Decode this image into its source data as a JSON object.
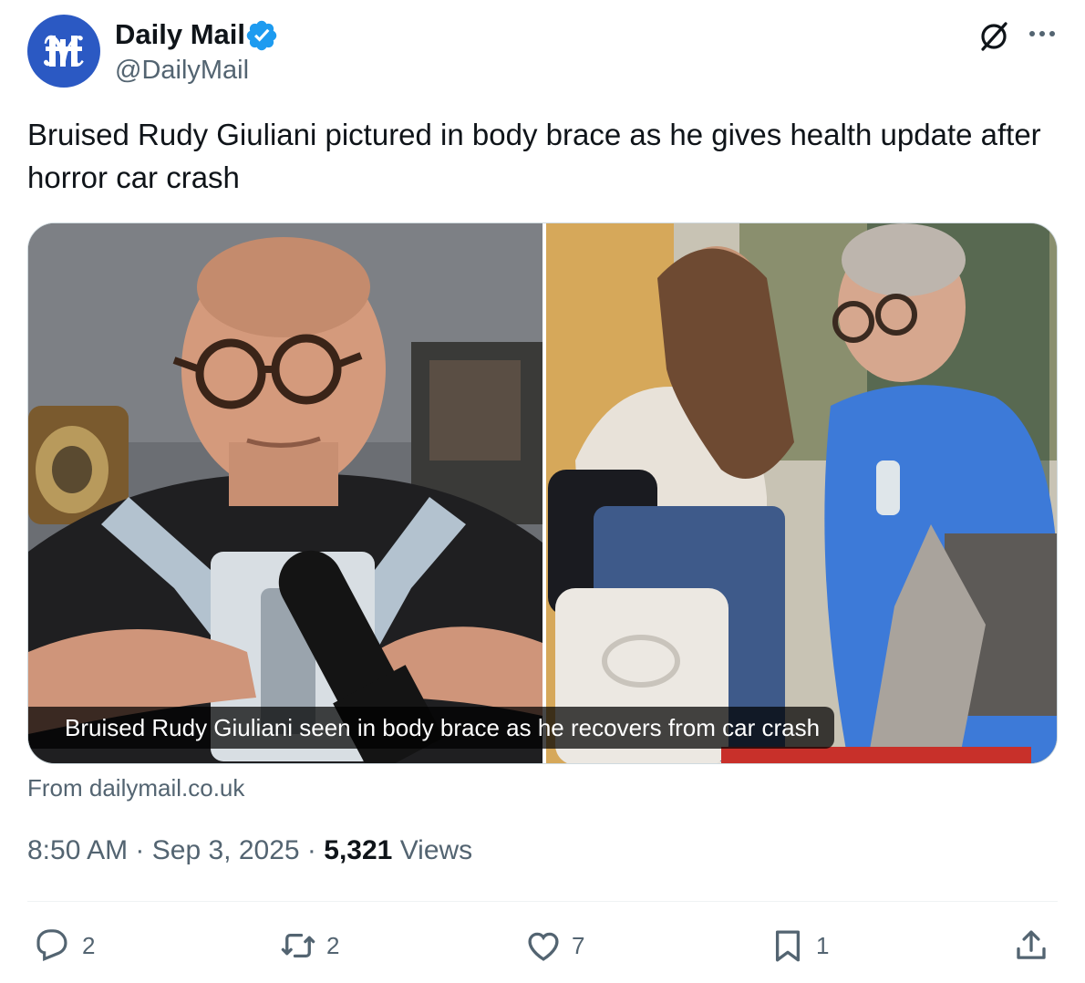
{
  "author": {
    "display_name": "Daily Mail",
    "handle": "@DailyMail",
    "verified": true,
    "avatar_icon": "daily-mail-logo",
    "avatar_color": "#2b59c3"
  },
  "tweet": {
    "text": "Bruised Rudy Giuliani pictured in body brace as he gives health update after horror car crash"
  },
  "media": {
    "caption": "Bruised Rudy Giuliani seen in body brace as he recovers from car crash",
    "source": "From dailymail.co.uk"
  },
  "meta": {
    "time": "8:50 AM",
    "separator": "·",
    "date": "Sep 3, 2025",
    "views_count": "5,321",
    "views_label": "Views"
  },
  "actions": {
    "replies": "2",
    "reposts": "2",
    "likes": "7",
    "bookmarks": "1"
  },
  "icons": {
    "verified": "verified-badge-icon",
    "grok": "grok-icon",
    "more": "more-icon",
    "reply": "reply-icon",
    "repost": "repost-icon",
    "like": "heart-icon",
    "bookmark": "bookmark-icon",
    "share": "share-icon"
  },
  "colors": {
    "verified_blue": "#1d9bf0",
    "secondary_text": "#536471",
    "primary_text": "#0f1419"
  }
}
